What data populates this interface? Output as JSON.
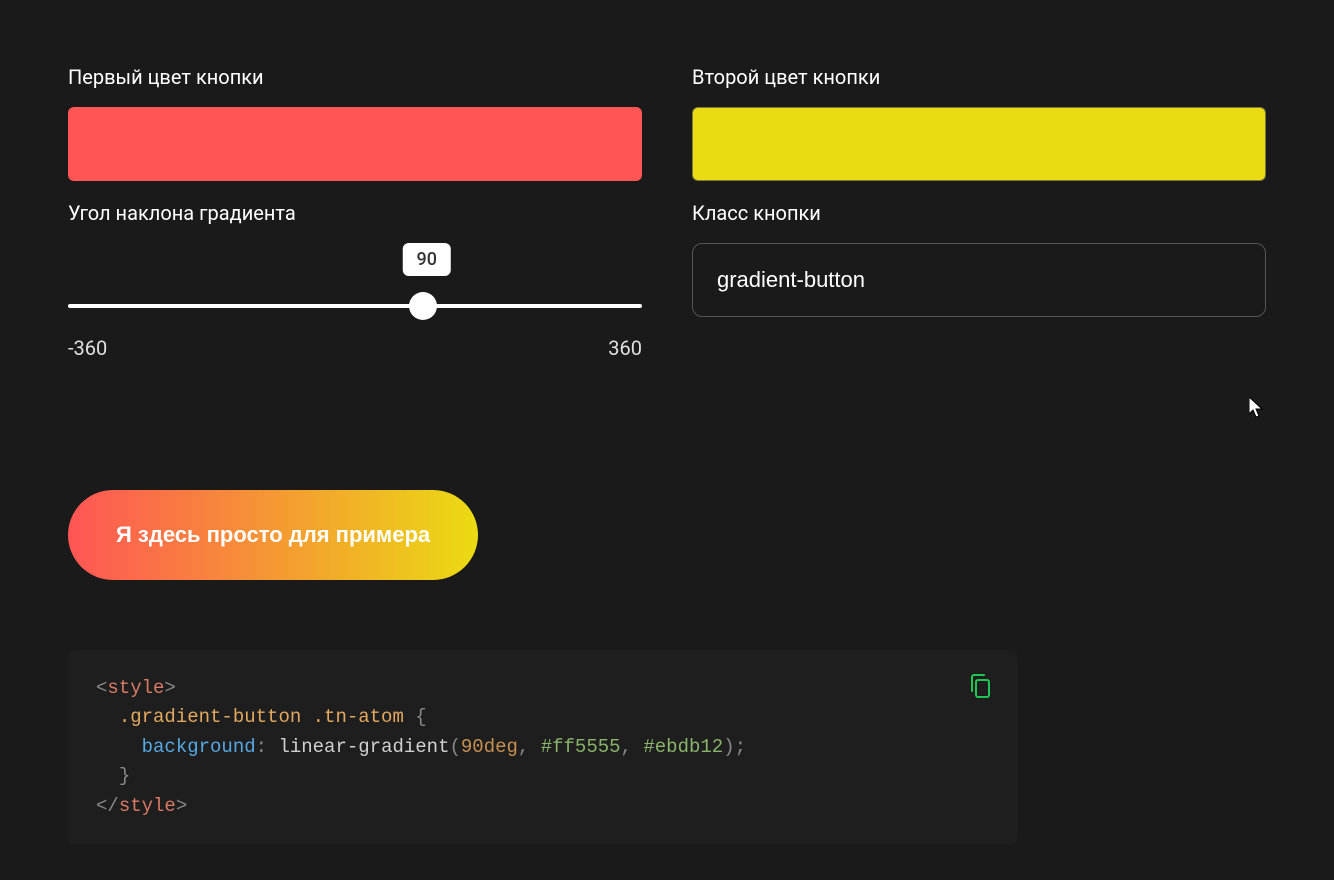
{
  "fields": {
    "color1_label": "Первый цвет кнопки",
    "color2_label": "Второй цвет кнопки",
    "angle_label": "Угол наклона градиента",
    "class_label": "Класс кнопки",
    "class_value": "gradient-button"
  },
  "colors": {
    "color1": "#ff5555",
    "color2": "#ebdb12"
  },
  "slider": {
    "min": "-360",
    "max": "360",
    "value": "90"
  },
  "preview": {
    "button_text": "Я здесь просто для примера"
  },
  "code": {
    "lt1": "<",
    "gt1": ">",
    "tag_style": "style",
    "sel": ".gradient-button .tn-atom",
    "brace_open": " {",
    "prop": "background",
    "colon": ": ",
    "func": "linear-gradient",
    "paren_open": "(",
    "deg": "90deg",
    "comma1": ", ",
    "hex1": "#ff5555",
    "comma2": ", ",
    "hex2": "#ebdb12",
    "paren_close_semi": ");",
    "brace_close": "}",
    "lt2": "</",
    "gt2": ">"
  }
}
